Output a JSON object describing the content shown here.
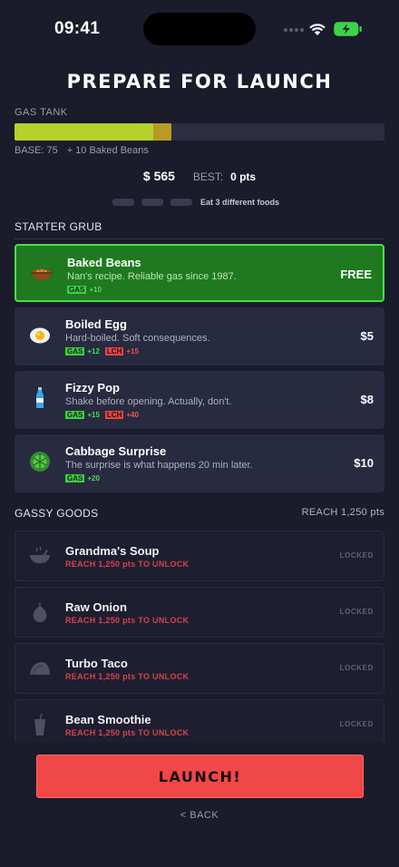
{
  "status": {
    "time": "09:41"
  },
  "title": "PREPARE FOR LAUNCH",
  "gas_tank": {
    "label": "GAS TANK",
    "base_text": "BASE: 75",
    "bonus_text": "+ 10 Baked Beans",
    "base_fill_fraction": 0.375,
    "bonus_fill_fraction": 0.05,
    "base_color": "#b5d12a",
    "bonus_color": "#b99a23"
  },
  "money": "$ 565",
  "best": {
    "label": "BEST:",
    "value": "0 pts"
  },
  "challenge": {
    "text": "Eat 3 different foods"
  },
  "starter": {
    "heading": "STARTER GRUB",
    "items": [
      {
        "name": "Baked Beans",
        "desc": "Nan's recipe. Reliable gas since 1987.",
        "price": "FREE",
        "icon": "bean-pot-icon",
        "gas": "+10",
        "lch": ""
      },
      {
        "name": "Boiled Egg",
        "desc": "Hard-boiled. Soft consequences.",
        "price": "$5",
        "icon": "egg-icon",
        "gas": "+12",
        "lch": "+15"
      },
      {
        "name": "Fizzy Pop",
        "desc": "Shake before opening. Actually, don't.",
        "price": "$8",
        "icon": "bottle-icon",
        "gas": "+15",
        "lch": "+40"
      },
      {
        "name": "Cabbage Surprise",
        "desc": "The surprise is what happens 20 min later.",
        "price": "$10",
        "icon": "cabbage-icon",
        "gas": "+20",
        "lch": ""
      }
    ],
    "gas_tag": "GAS",
    "lch_tag": "LCH"
  },
  "gassy": {
    "heading": "GASSY GOODS",
    "requirement": "REACH 1,250 pts",
    "locked_label": "LOCKED",
    "unlock_text": "REACH 1,250 pts TO UNLOCK",
    "items": [
      {
        "name": "Grandma's Soup",
        "icon": "soup-bowl-icon"
      },
      {
        "name": "Raw Onion",
        "icon": "onion-icon"
      },
      {
        "name": "Turbo Taco",
        "icon": "taco-icon"
      },
      {
        "name": "Bean Smoothie",
        "icon": "smoothie-icon"
      }
    ]
  },
  "launch_label": "LAUNCH!",
  "back_label": "< BACK",
  "colors": {
    "background": "#1a1b2b",
    "selected_card": "#1f7a1f",
    "launch": "#f24747",
    "gas_tag": "#3fcc42",
    "lch_tag": "#e24646"
  }
}
